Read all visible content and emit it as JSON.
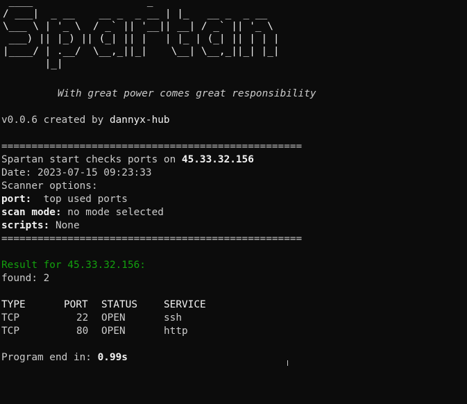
{
  "banner": " ____                   _\n/ ___|  _ __    __ _  _ __ | |_   __ _  _ __\n\\___ \\ | '_ \\  / _` || '__|| __| / _` || '_ \\\n ___) || |_) || (_| || |   | |_ | (_| || | | |\n|____/ | .__/  \\__,_||_|    \\__| \\__,_||_| |_|\n       |_|",
  "tagline": "With great power comes great responsibility",
  "version_line": {
    "prefix": "v0.0.6 created by ",
    "author": "dannyx-hub"
  },
  "separator": "==================================================",
  "scan_header": {
    "prefix": "Spartan start checks ports on ",
    "ip": "45.33.32.156"
  },
  "date_line": "Date: 2023-07-15 09:23:33",
  "scanner_options_label": "Scanner options:",
  "options": {
    "port_key": "port:",
    "port_value": "  top used ports",
    "scan_mode_key": "scan mode:",
    "scan_mode_value": " no mode selected",
    "scripts_key": "scripts:",
    "scripts_value": " None"
  },
  "result_line": "Result for 45.33.32.156:",
  "found_line": "found: 2",
  "table": {
    "headers": [
      "TYPE",
      "PORT",
      "STATUS",
      "SERVICE"
    ],
    "rows": [
      [
        "TCP",
        "22",
        "OPEN",
        "ssh"
      ],
      [
        "TCP",
        "80",
        "OPEN",
        "http"
      ]
    ]
  },
  "program_end": {
    "prefix": "Program end in: ",
    "value": "0.99s"
  },
  "colors": {
    "background": "#0c0c0c",
    "text": "#cccccc",
    "bright": "#f2f2f2",
    "green": "#13a10e"
  }
}
